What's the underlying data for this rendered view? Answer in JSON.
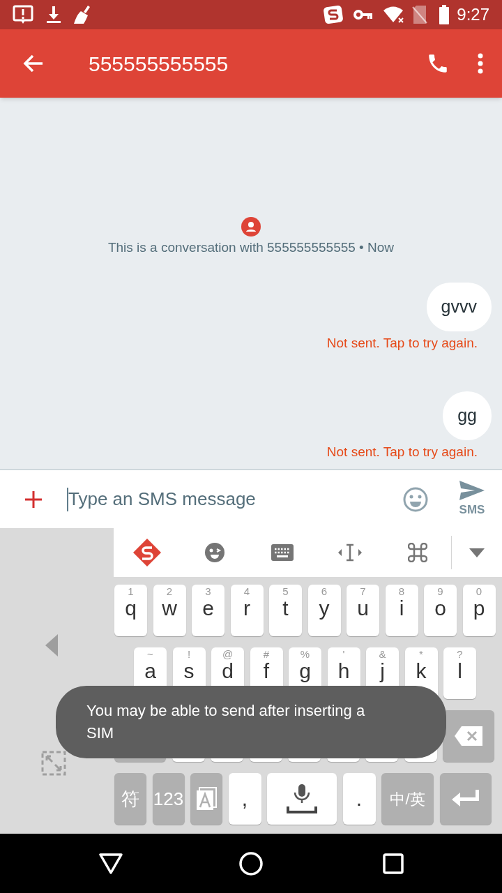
{
  "status_bar": {
    "time": "9:27"
  },
  "app_bar": {
    "title": "555555555555"
  },
  "conversation": {
    "info": "This is a conversation with 555555555555 • Now",
    "messages": [
      {
        "text": "gvvv",
        "status": "Not sent. Tap to try again."
      },
      {
        "text": "gg",
        "status": "Not sent. Tap to try again."
      }
    ]
  },
  "compose": {
    "placeholder": "Type an SMS message",
    "send_label": "SMS"
  },
  "keyboard": {
    "key_rows": [
      {
        "keys": [
          {
            "kind": "letter",
            "hint": "1",
            "label": "q"
          },
          {
            "kind": "letter",
            "hint": "2",
            "label": "w"
          },
          {
            "kind": "letter",
            "hint": "3",
            "label": "e"
          },
          {
            "kind": "letter",
            "hint": "4",
            "label": "r"
          },
          {
            "kind": "letter",
            "hint": "5",
            "label": "t"
          },
          {
            "kind": "letter",
            "hint": "6",
            "label": "y"
          },
          {
            "kind": "letter",
            "hint": "7",
            "label": "u"
          },
          {
            "kind": "letter",
            "hint": "8",
            "label": "i"
          },
          {
            "kind": "letter",
            "hint": "9",
            "label": "o"
          },
          {
            "kind": "letter",
            "hint": "0",
            "label": "p"
          }
        ]
      },
      {
        "keys": [
          {
            "kind": "letter",
            "hint": "~",
            "label": "a"
          },
          {
            "kind": "letter",
            "hint": "!",
            "label": "s"
          },
          {
            "kind": "letter",
            "hint": "@",
            "label": "d"
          },
          {
            "kind": "letter",
            "hint": "#",
            "label": "f"
          },
          {
            "kind": "letter",
            "hint": "%",
            "label": "g"
          },
          {
            "kind": "letter",
            "hint": "'",
            "label": "h"
          },
          {
            "kind": "letter",
            "hint": "&",
            "label": "j"
          },
          {
            "kind": "letter",
            "hint": "*",
            "label": "k"
          },
          {
            "kind": "letter",
            "hint": "?",
            "label": "l"
          }
        ]
      },
      {
        "keys": [
          {
            "kind": "shift"
          },
          {
            "kind": "letter"
          },
          {
            "kind": "letter"
          },
          {
            "kind": "letter"
          },
          {
            "kind": "letter"
          },
          {
            "kind": "letter"
          },
          {
            "kind": "letter"
          },
          {
            "kind": "letter"
          },
          {
            "kind": "delete"
          }
        ]
      },
      {
        "keys": [
          {
            "kind": "func",
            "label": "符"
          },
          {
            "kind": "func",
            "label": "123"
          },
          {
            "kind": "mode"
          },
          {
            "kind": "letter",
            "label": ","
          },
          {
            "kind": "space"
          },
          {
            "kind": "letter",
            "label": "."
          },
          {
            "kind": "lang",
            "label": "中/英"
          },
          {
            "kind": "enter"
          }
        ]
      }
    ]
  },
  "toast": {
    "text": "You may be able to send after inserting a SIM"
  }
}
